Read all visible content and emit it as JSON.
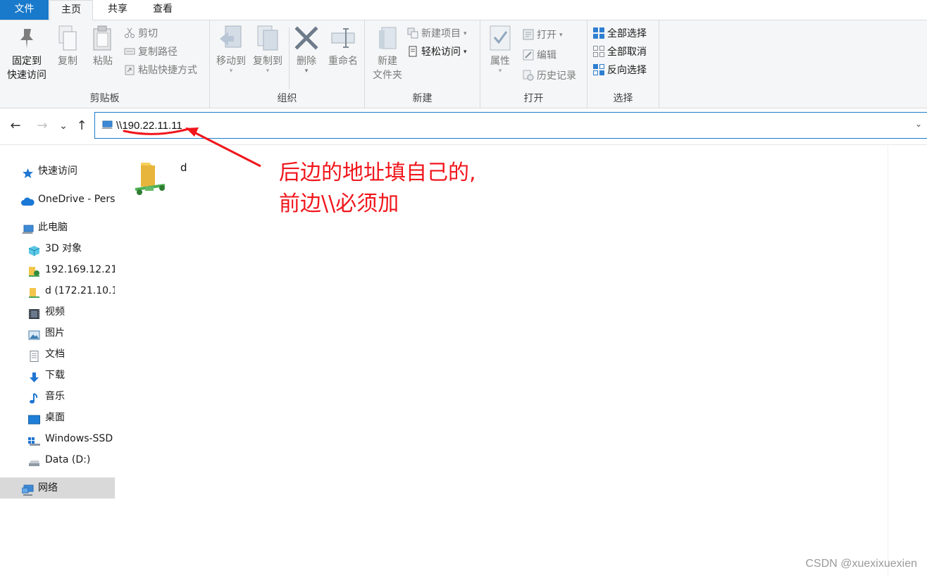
{
  "ribbon_tabs": [
    "文件",
    "主页",
    "共享",
    "查看"
  ],
  "clipboard": {
    "pin_label_1": "固定到",
    "pin_label_2": "快速访问",
    "copy_label": "复制",
    "paste_label": "粘贴",
    "cut_label": "剪切",
    "copy_path_label": "复制路径",
    "paste_shortcut_label": "粘贴快捷方式",
    "group_label": "剪贴板"
  },
  "organize": {
    "move_to_label": "移动到",
    "copy_to_label": "复制到",
    "delete_label": "删除",
    "rename_label": "重命名",
    "group_label": "组织"
  },
  "new": {
    "new_folder_label_1": "新建",
    "new_folder_label_2": "文件夹",
    "new_item_label": "新建项目",
    "easy_access_label": "轻松访问",
    "group_label": "新建"
  },
  "open": {
    "properties_label": "属性",
    "open_label": "打开",
    "edit_label": "编辑",
    "history_label": "历史记录",
    "group_label": "打开"
  },
  "select": {
    "select_all_label": "全部选择",
    "select_none_label": "全部取消",
    "invert_label": "反向选择",
    "group_label": "选择"
  },
  "address": {
    "value": "\\\\190.22.11.11",
    "back_glyph": "←",
    "forward_glyph": "→",
    "recent_glyph": "⌄",
    "up_glyph": "↑",
    "dropdown_glyph": "⌄"
  },
  "sidebar": {
    "items": [
      {
        "label": "快速访问",
        "icon": "star-icon"
      },
      {
        "label": "OneDrive - Pers",
        "icon": "cloud-icon"
      },
      {
        "label": "此电脑",
        "icon": "computer-icon"
      },
      {
        "label": "3D 对象",
        "icon": "cube-icon"
      },
      {
        "label": "192.169.12.21",
        "icon": "network-drive-icon"
      },
      {
        "label": "d (172.21.10.1",
        "icon": "network-drive-icon"
      },
      {
        "label": "视频",
        "icon": "video-icon"
      },
      {
        "label": "图片",
        "icon": "picture-icon"
      },
      {
        "label": "文档",
        "icon": "document-icon"
      },
      {
        "label": "下载",
        "icon": "download-icon"
      },
      {
        "label": "音乐",
        "icon": "music-icon"
      },
      {
        "label": "桌面",
        "icon": "desktop-icon"
      },
      {
        "label": "Windows-SSD",
        "icon": "windows-drive-icon"
      },
      {
        "label": "Data (D:)",
        "icon": "drive-icon"
      },
      {
        "label": "网络",
        "icon": "network-icon"
      }
    ]
  },
  "content": {
    "items": [
      {
        "name": "d",
        "icon": "shared-folder-icon"
      }
    ]
  },
  "annotation": {
    "line1": "后边的地址填自己的,",
    "line2": "前边\\\\必须加",
    "color": "#f0161c"
  },
  "watermark": "CSDN @xuexixuexien",
  "colors": {
    "accent": "#1979ca",
    "selection": "#d9d9d9"
  }
}
